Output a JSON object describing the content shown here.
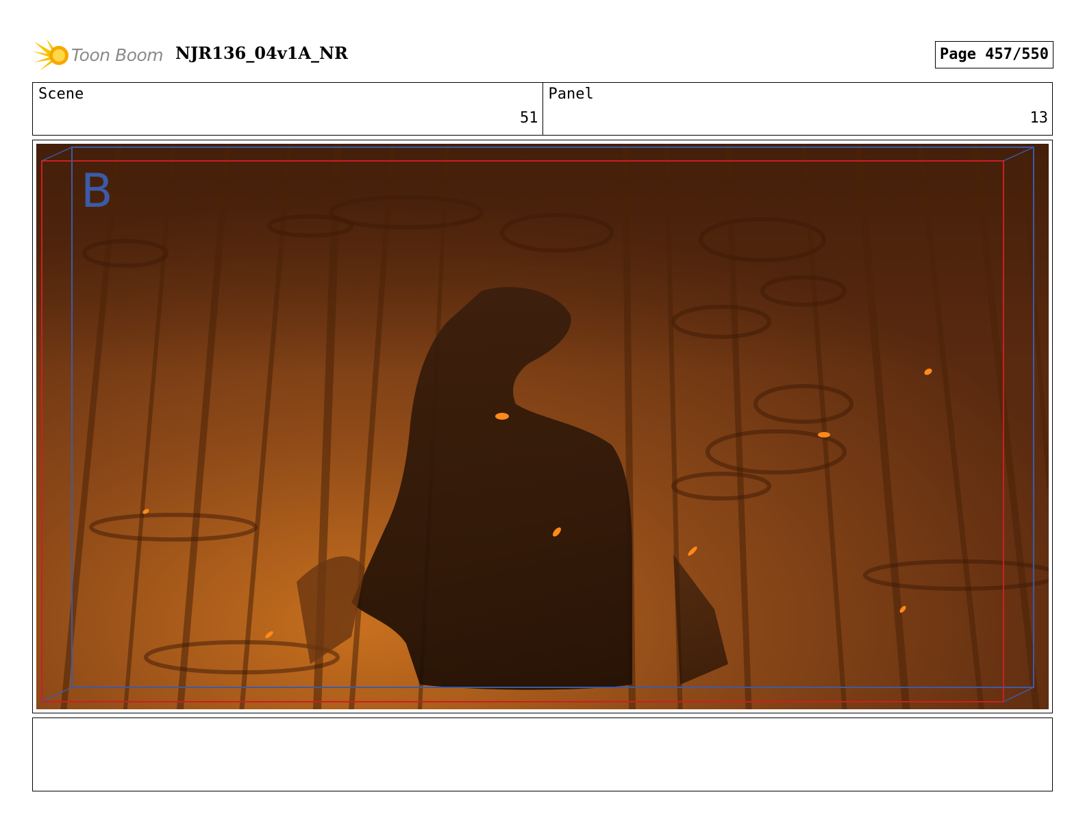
{
  "header": {
    "logo_text": "Toon Boom",
    "project_title": "NJR136_04v1A_NR",
    "page_label": "Page 457/550"
  },
  "info": {
    "scene_label": "Scene",
    "scene_value": "51",
    "panel_label": "Panel",
    "panel_value": "13"
  },
  "panel": {
    "camera_letter": "B",
    "colors": {
      "background": "#7a3d14",
      "highlight": "#c66a1e",
      "silhouette": "#2a1508",
      "ember": "#ff8a1a",
      "safe_frame_red": "#cc1f1f",
      "camera_frame_blue": "#3b5ba8"
    }
  },
  "notes": {
    "text": ""
  }
}
